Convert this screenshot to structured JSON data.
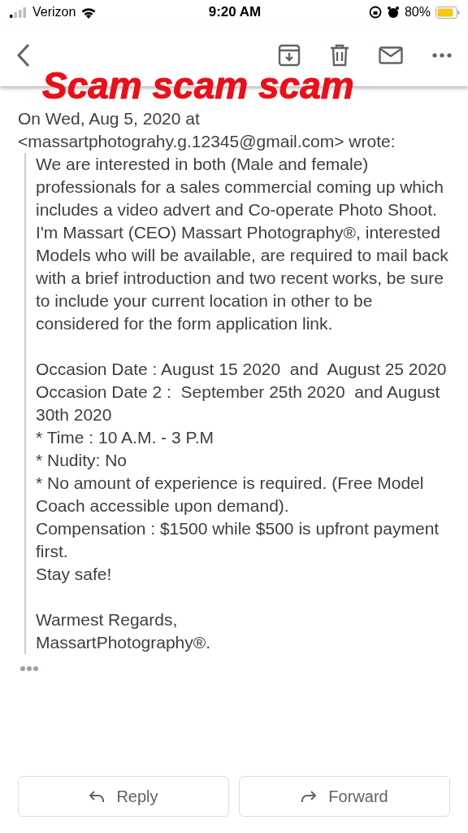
{
  "status_bar": {
    "carrier": "Verizon",
    "time": "9:20 AM",
    "battery": "80%"
  },
  "annotation": "Scam scam scam",
  "message": {
    "header": "On Wed, Aug 5, 2020 at",
    "sender_email": "<massartphotograhy.g.12345@gmail.com> wrote:",
    "quoted_blocks": [
      [
        "We are interested in both (Male and female) professionals for a sales commercial coming up which includes a video advert and Co-operate Photo Shoot.",
        "I'm Massart (CEO) Massart Photography®, interested Models who will be available, are required to mail back with a brief introduction and two recent works, be sure to include your current location in other to be considered for the form application link."
      ],
      [
        "Occasion Date : August 15 2020  and  August 25 2020",
        "Occasion Date 2 :  September 25th 2020  and August 30th 2020",
        "* Time : 10 A.M. - 3 P.M",
        "* Nudity: No",
        "* No amount of experience is required. (Free Model Coach accessible upon demand).",
        "Compensation : $1500 while $500 is upfront payment first.",
        "Stay safe!"
      ],
      [
        "Warmest Regards,",
        "MassartPhotography®."
      ]
    ]
  },
  "buttons": [
    {
      "kind": "reply",
      "label": "Reply"
    },
    {
      "kind": "forward",
      "label": "Forward"
    }
  ]
}
